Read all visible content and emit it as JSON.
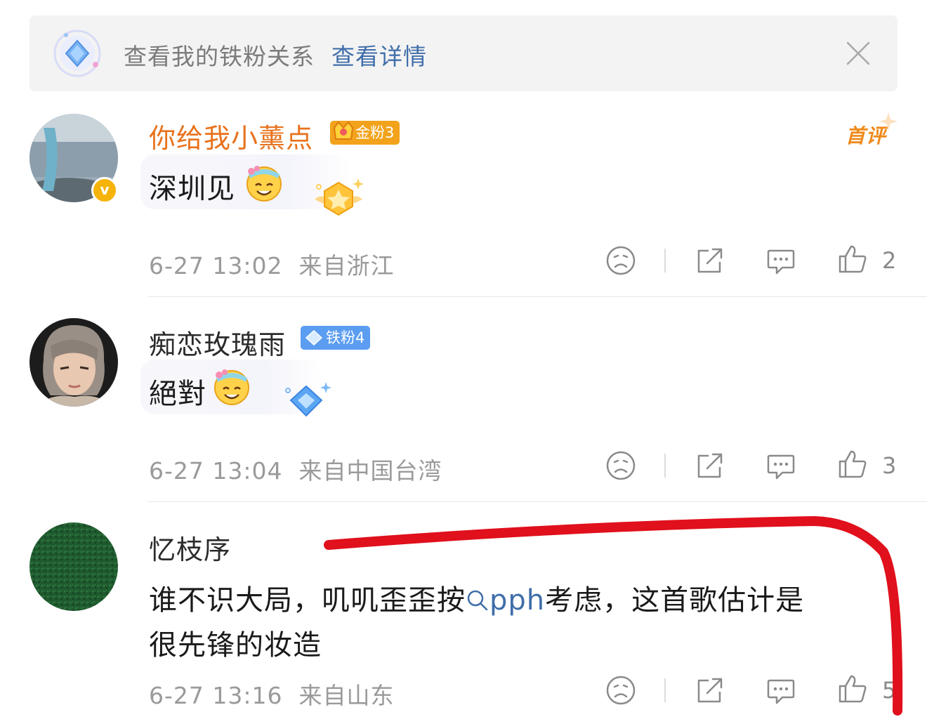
{
  "banner": {
    "text": "查看我的铁粉关系",
    "link": "查看详情"
  },
  "comments": [
    {
      "username": "你给我小薰点",
      "username_color": "#e8721d",
      "badge": "金粉3",
      "badge_color": "#f2a31b",
      "first_tag": "首评",
      "text": "深圳见",
      "time": "6-27 13:02",
      "location": "来自浙江",
      "likes": "2"
    },
    {
      "username": "痴恋玫瑰雨",
      "username_color": "#2b2b2b",
      "badge": "铁粉4",
      "badge_color": "#5b9df0",
      "text": "絕對",
      "time": "6-27 13:04",
      "location": "来自中国台湾",
      "likes": "3"
    },
    {
      "username": "忆枝序",
      "username_color": "#2b2b2b",
      "text_before": "谁不识大局，叽叽歪歪按",
      "search_link": "pph",
      "text_after": "考虑，这首歌估计是",
      "text_line2": "很先锋的妆造",
      "time": "6-27 13:16",
      "location": "来自山东",
      "likes": "5"
    }
  ],
  "colors": {
    "accent_link": "#3f6ea9",
    "annotation_red": "#e0101c"
  }
}
